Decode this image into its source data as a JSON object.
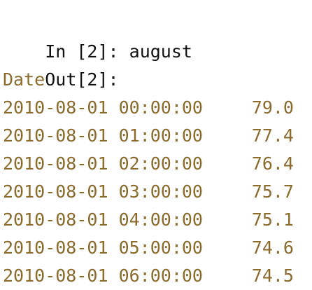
{
  "colors": {
    "prompt_text": "#111111",
    "output_text": "#8b6a2c",
    "background": "#ffffff"
  },
  "console": {
    "input_prompt": "In [2]: ",
    "input_command": "august",
    "output_prompt": "Out[2]:",
    "index_header": "Date",
    "rows": [
      {
        "datetime": "2010-08-01 00:00:00",
        "value": "79.0"
      },
      {
        "datetime": "2010-08-01 01:00:00",
        "value": "77.4"
      },
      {
        "datetime": "2010-08-01 02:00:00",
        "value": "76.4"
      },
      {
        "datetime": "2010-08-01 03:00:00",
        "value": "75.7"
      },
      {
        "datetime": "2010-08-01 04:00:00",
        "value": "75.1"
      },
      {
        "datetime": "2010-08-01 05:00:00",
        "value": "74.6"
      },
      {
        "datetime": "2010-08-01 06:00:00",
        "value": "74.5"
      }
    ]
  }
}
